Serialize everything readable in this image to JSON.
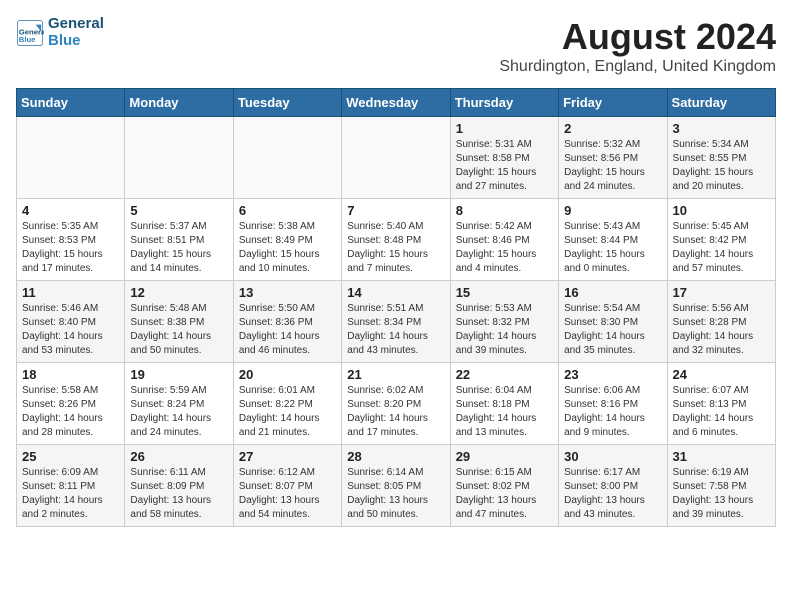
{
  "header": {
    "logo_line1": "General",
    "logo_line2": "Blue",
    "month_title": "August 2024",
    "location": "Shurdington, England, United Kingdom"
  },
  "days_of_week": [
    "Sunday",
    "Monday",
    "Tuesday",
    "Wednesday",
    "Thursday",
    "Friday",
    "Saturday"
  ],
  "weeks": [
    [
      {
        "day": "",
        "info": ""
      },
      {
        "day": "",
        "info": ""
      },
      {
        "day": "",
        "info": ""
      },
      {
        "day": "",
        "info": ""
      },
      {
        "day": "1",
        "info": "Sunrise: 5:31 AM\nSunset: 8:58 PM\nDaylight: 15 hours\nand 27 minutes."
      },
      {
        "day": "2",
        "info": "Sunrise: 5:32 AM\nSunset: 8:56 PM\nDaylight: 15 hours\nand 24 minutes."
      },
      {
        "day": "3",
        "info": "Sunrise: 5:34 AM\nSunset: 8:55 PM\nDaylight: 15 hours\nand 20 minutes."
      }
    ],
    [
      {
        "day": "4",
        "info": "Sunrise: 5:35 AM\nSunset: 8:53 PM\nDaylight: 15 hours\nand 17 minutes."
      },
      {
        "day": "5",
        "info": "Sunrise: 5:37 AM\nSunset: 8:51 PM\nDaylight: 15 hours\nand 14 minutes."
      },
      {
        "day": "6",
        "info": "Sunrise: 5:38 AM\nSunset: 8:49 PM\nDaylight: 15 hours\nand 10 minutes."
      },
      {
        "day": "7",
        "info": "Sunrise: 5:40 AM\nSunset: 8:48 PM\nDaylight: 15 hours\nand 7 minutes."
      },
      {
        "day": "8",
        "info": "Sunrise: 5:42 AM\nSunset: 8:46 PM\nDaylight: 15 hours\nand 4 minutes."
      },
      {
        "day": "9",
        "info": "Sunrise: 5:43 AM\nSunset: 8:44 PM\nDaylight: 15 hours\nand 0 minutes."
      },
      {
        "day": "10",
        "info": "Sunrise: 5:45 AM\nSunset: 8:42 PM\nDaylight: 14 hours\nand 57 minutes."
      }
    ],
    [
      {
        "day": "11",
        "info": "Sunrise: 5:46 AM\nSunset: 8:40 PM\nDaylight: 14 hours\nand 53 minutes."
      },
      {
        "day": "12",
        "info": "Sunrise: 5:48 AM\nSunset: 8:38 PM\nDaylight: 14 hours\nand 50 minutes."
      },
      {
        "day": "13",
        "info": "Sunrise: 5:50 AM\nSunset: 8:36 PM\nDaylight: 14 hours\nand 46 minutes."
      },
      {
        "day": "14",
        "info": "Sunrise: 5:51 AM\nSunset: 8:34 PM\nDaylight: 14 hours\nand 43 minutes."
      },
      {
        "day": "15",
        "info": "Sunrise: 5:53 AM\nSunset: 8:32 PM\nDaylight: 14 hours\nand 39 minutes."
      },
      {
        "day": "16",
        "info": "Sunrise: 5:54 AM\nSunset: 8:30 PM\nDaylight: 14 hours\nand 35 minutes."
      },
      {
        "day": "17",
        "info": "Sunrise: 5:56 AM\nSunset: 8:28 PM\nDaylight: 14 hours\nand 32 minutes."
      }
    ],
    [
      {
        "day": "18",
        "info": "Sunrise: 5:58 AM\nSunset: 8:26 PM\nDaylight: 14 hours\nand 28 minutes."
      },
      {
        "day": "19",
        "info": "Sunrise: 5:59 AM\nSunset: 8:24 PM\nDaylight: 14 hours\nand 24 minutes."
      },
      {
        "day": "20",
        "info": "Sunrise: 6:01 AM\nSunset: 8:22 PM\nDaylight: 14 hours\nand 21 minutes."
      },
      {
        "day": "21",
        "info": "Sunrise: 6:02 AM\nSunset: 8:20 PM\nDaylight: 14 hours\nand 17 minutes."
      },
      {
        "day": "22",
        "info": "Sunrise: 6:04 AM\nSunset: 8:18 PM\nDaylight: 14 hours\nand 13 minutes."
      },
      {
        "day": "23",
        "info": "Sunrise: 6:06 AM\nSunset: 8:16 PM\nDaylight: 14 hours\nand 9 minutes."
      },
      {
        "day": "24",
        "info": "Sunrise: 6:07 AM\nSunset: 8:13 PM\nDaylight: 14 hours\nand 6 minutes."
      }
    ],
    [
      {
        "day": "25",
        "info": "Sunrise: 6:09 AM\nSunset: 8:11 PM\nDaylight: 14 hours\nand 2 minutes."
      },
      {
        "day": "26",
        "info": "Sunrise: 6:11 AM\nSunset: 8:09 PM\nDaylight: 13 hours\nand 58 minutes."
      },
      {
        "day": "27",
        "info": "Sunrise: 6:12 AM\nSunset: 8:07 PM\nDaylight: 13 hours\nand 54 minutes."
      },
      {
        "day": "28",
        "info": "Sunrise: 6:14 AM\nSunset: 8:05 PM\nDaylight: 13 hours\nand 50 minutes."
      },
      {
        "day": "29",
        "info": "Sunrise: 6:15 AM\nSunset: 8:02 PM\nDaylight: 13 hours\nand 47 minutes."
      },
      {
        "day": "30",
        "info": "Sunrise: 6:17 AM\nSunset: 8:00 PM\nDaylight: 13 hours\nand 43 minutes."
      },
      {
        "day": "31",
        "info": "Sunrise: 6:19 AM\nSunset: 7:58 PM\nDaylight: 13 hours\nand 39 minutes."
      }
    ]
  ]
}
